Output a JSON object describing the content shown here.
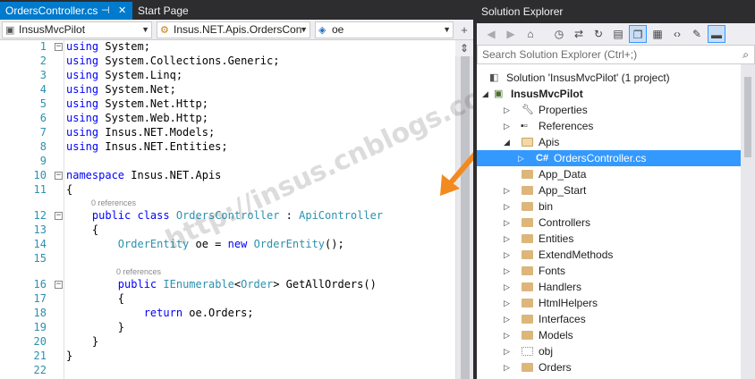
{
  "doc_tabs": [
    {
      "label": "OrdersController.cs",
      "active": true
    },
    {
      "label": "Start Page",
      "active": false
    }
  ],
  "nav": {
    "project": "InsusMvcPilot",
    "type": "Insus.NET.Apis.OrdersCon",
    "member": "oe"
  },
  "code": {
    "line_numbers": [
      "1",
      "2",
      "3",
      "4",
      "5",
      "6",
      "7",
      "8",
      "9",
      "10",
      "11",
      "12",
      "13",
      "14",
      "15",
      "16",
      "17",
      "18",
      "19",
      "20",
      "21",
      "22"
    ],
    "references_label": "0 references"
  },
  "watermark": "http://insus.cnblogs.com",
  "colors": {
    "tab_active": "#007acc",
    "keyword": "#0000ff",
    "type": "#2b91af",
    "selection": "#3399ff",
    "arrow": "#f28a1e"
  },
  "solution_explorer": {
    "title": "Solution Explorer",
    "search_placeholder": "Search Solution Explorer (Ctrl+;)",
    "tree": [
      {
        "label": "Solution 'InsusMvcPilot' (1 project)",
        "icon": "solution-icon"
      },
      {
        "label": "InsusMvcPilot",
        "icon": "project-icon",
        "bold": true
      },
      {
        "label": "Properties",
        "icon": "wrench-icon"
      },
      {
        "label": "References",
        "icon": "references-icon"
      },
      {
        "label": "Apis",
        "icon": "folder-open-icon"
      },
      {
        "label": "OrdersController.cs",
        "icon": "csharp-file-icon",
        "selected": true
      },
      {
        "label": "App_Data",
        "icon": "folder-icon"
      },
      {
        "label": "App_Start",
        "icon": "folder-icon"
      },
      {
        "label": "bin",
        "icon": "folder-icon"
      },
      {
        "label": "Controllers",
        "icon": "folder-icon"
      },
      {
        "label": "Entities",
        "icon": "folder-icon"
      },
      {
        "label": "ExtendMethods",
        "icon": "folder-icon"
      },
      {
        "label": "Fonts",
        "icon": "folder-icon"
      },
      {
        "label": "Handlers",
        "icon": "folder-icon"
      },
      {
        "label": "HtmlHelpers",
        "icon": "folder-icon"
      },
      {
        "label": "Interfaces",
        "icon": "folder-icon"
      },
      {
        "label": "Models",
        "icon": "folder-icon"
      },
      {
        "label": "obj",
        "icon": "dotted-folder-icon"
      },
      {
        "label": "Orders",
        "icon": "folder-icon"
      }
    ]
  }
}
